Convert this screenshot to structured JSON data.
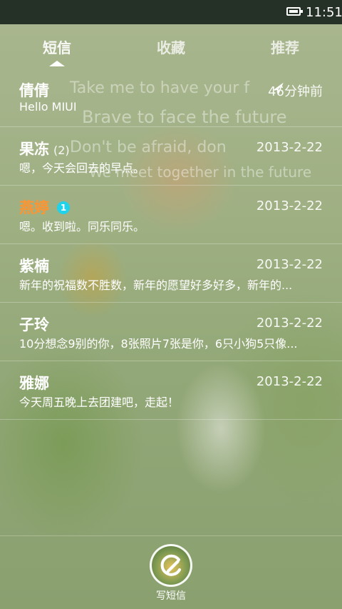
{
  "status_bar": {
    "time": "11:51"
  },
  "tabs": [
    {
      "label": "短信",
      "active": true
    },
    {
      "label": "收藏",
      "active": false
    },
    {
      "label": "推荐",
      "active": false
    }
  ],
  "background_lyrics": [
    "Take me to have your f",
    "Brave to face the future",
    "Don't be afraid,   don",
    "We meet together in the future"
  ],
  "conversations": [
    {
      "name": "倩倩",
      "count": "",
      "unread_badge": "",
      "time": "46分钟前",
      "preview": "Hello MIUI",
      "sent_indicator": true
    },
    {
      "name": "果冻",
      "count": "(2)",
      "unread_badge": "",
      "time": "2013-2-22",
      "preview": "嗯，今天会回去的早点。"
    },
    {
      "name": "燕婷",
      "count": "",
      "unread_badge": "1",
      "time": "2013-2-22",
      "preview": "嗯。收到啦。同乐同乐。",
      "highlight_color": "#ff9430"
    },
    {
      "name": "紫楠",
      "count": "",
      "unread_badge": "",
      "time": "2013-2-22",
      "preview": "新年的祝福数不胜数，新年的愿望好多好多，新年的..."
    },
    {
      "name": "子玲",
      "count": "",
      "unread_badge": "",
      "time": "2013-2-22",
      "preview": "10分想念9别的你，8张照片7张是你，6只小狗5只像..."
    },
    {
      "name": "雅娜",
      "count": "",
      "unread_badge": "",
      "time": "2013-2-22",
      "preview": "今天周五晚上去团建吧，走起！"
    }
  ],
  "compose": {
    "label": "写短信"
  },
  "colors": {
    "status_bar": "#253027",
    "badge": "#20d2ea",
    "unread_name": "#ff9430"
  }
}
